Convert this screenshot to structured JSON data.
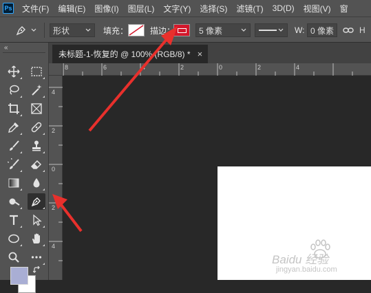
{
  "app": {
    "logo_text": "Ps",
    "menu": [
      "文件(F)",
      "编辑(E)",
      "图像(I)",
      "图层(L)",
      "文字(Y)",
      "选择(S)",
      "滤镜(T)",
      "3D(D)",
      "视图(V)",
      "窗"
    ]
  },
  "options": {
    "mode_value": "形状",
    "fill_label": "填充：",
    "stroke_label": "描边：",
    "stroke_width_value": "5 像素",
    "w_label": "W:",
    "w_value": "0 像素",
    "collapse_glyph": "«"
  },
  "document": {
    "tab_title": "未标题-1-恢复的 @ 100% (RGB/8) *",
    "close_glyph": "×"
  },
  "rulers": {
    "top_labels": [
      "8",
      "6",
      "4",
      "2",
      "0",
      "2",
      "4"
    ],
    "left_labels": [
      "4",
      "2",
      "0",
      "2",
      "4"
    ]
  },
  "colors": {
    "stroke_color": "#d3172b",
    "arrow_color": "#e8302c",
    "foreground_swatch": "#a9aed4",
    "background_swatch": "#ffffff"
  },
  "toolbar": {
    "tools": [
      "move-icon",
      "marquee-icon",
      "lasso-icon",
      "magic-wand-icon",
      "crop-icon",
      "frame-icon",
      "eyedropper-icon",
      "healing-brush-icon",
      "brush-icon",
      "stamp-icon",
      "history-brush-icon",
      "eraser-icon",
      "gradient-icon",
      "blur-icon",
      "dodge-icon",
      "pen-icon",
      "text-icon",
      "path-selection-icon",
      "shape-icon",
      "hand-icon",
      "zoom-icon",
      "more-tools-icon"
    ]
  },
  "watermark": {
    "line1": "Baidu 经验",
    "line2": "jingyan.baidu.com"
  }
}
